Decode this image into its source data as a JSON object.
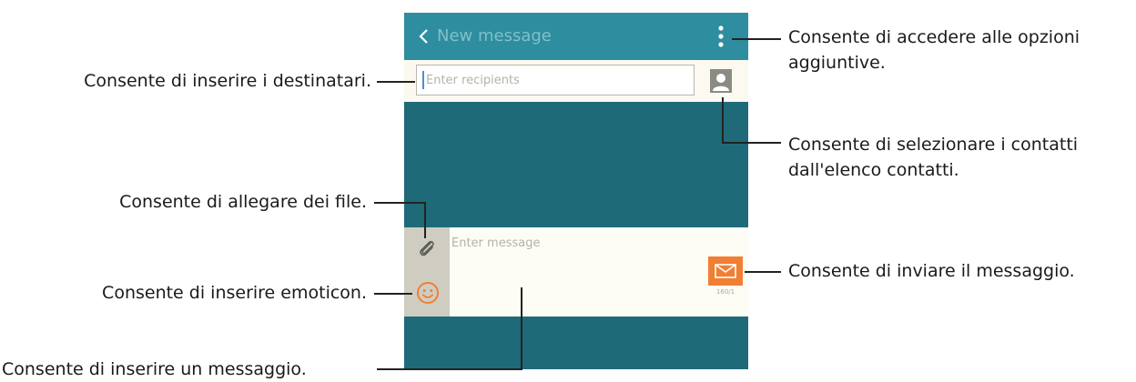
{
  "screen": {
    "title": "New message",
    "recipients_placeholder": "Enter recipients",
    "message_placeholder": "Enter message",
    "counter": "160/1"
  },
  "callouts": {
    "options": {
      "line1": "Consente di accedere alle opzioni",
      "line2": "aggiuntive."
    },
    "recipients": "Consente di inserire i destinatari.",
    "contacts": {
      "line1": "Consente di selezionare i contatti",
      "line2": "dall'elenco contatti."
    },
    "attach": "Consente di allegare dei file.",
    "emoticon": "Consente di inserire emoticon.",
    "send": "Consente di inviare il messaggio.",
    "message": "Consente di inserire un messaggio."
  },
  "colors": {
    "appbar": "#2e8d9e",
    "background": "#1e6a79",
    "compose_area": "#fdfcf5",
    "tools_column": "#cfcdc2",
    "send_button": "#f07f33"
  },
  "icons": [
    "back-icon",
    "more-options-icon",
    "contact-icon",
    "attach-icon",
    "emoticon-icon",
    "send-icon"
  ]
}
